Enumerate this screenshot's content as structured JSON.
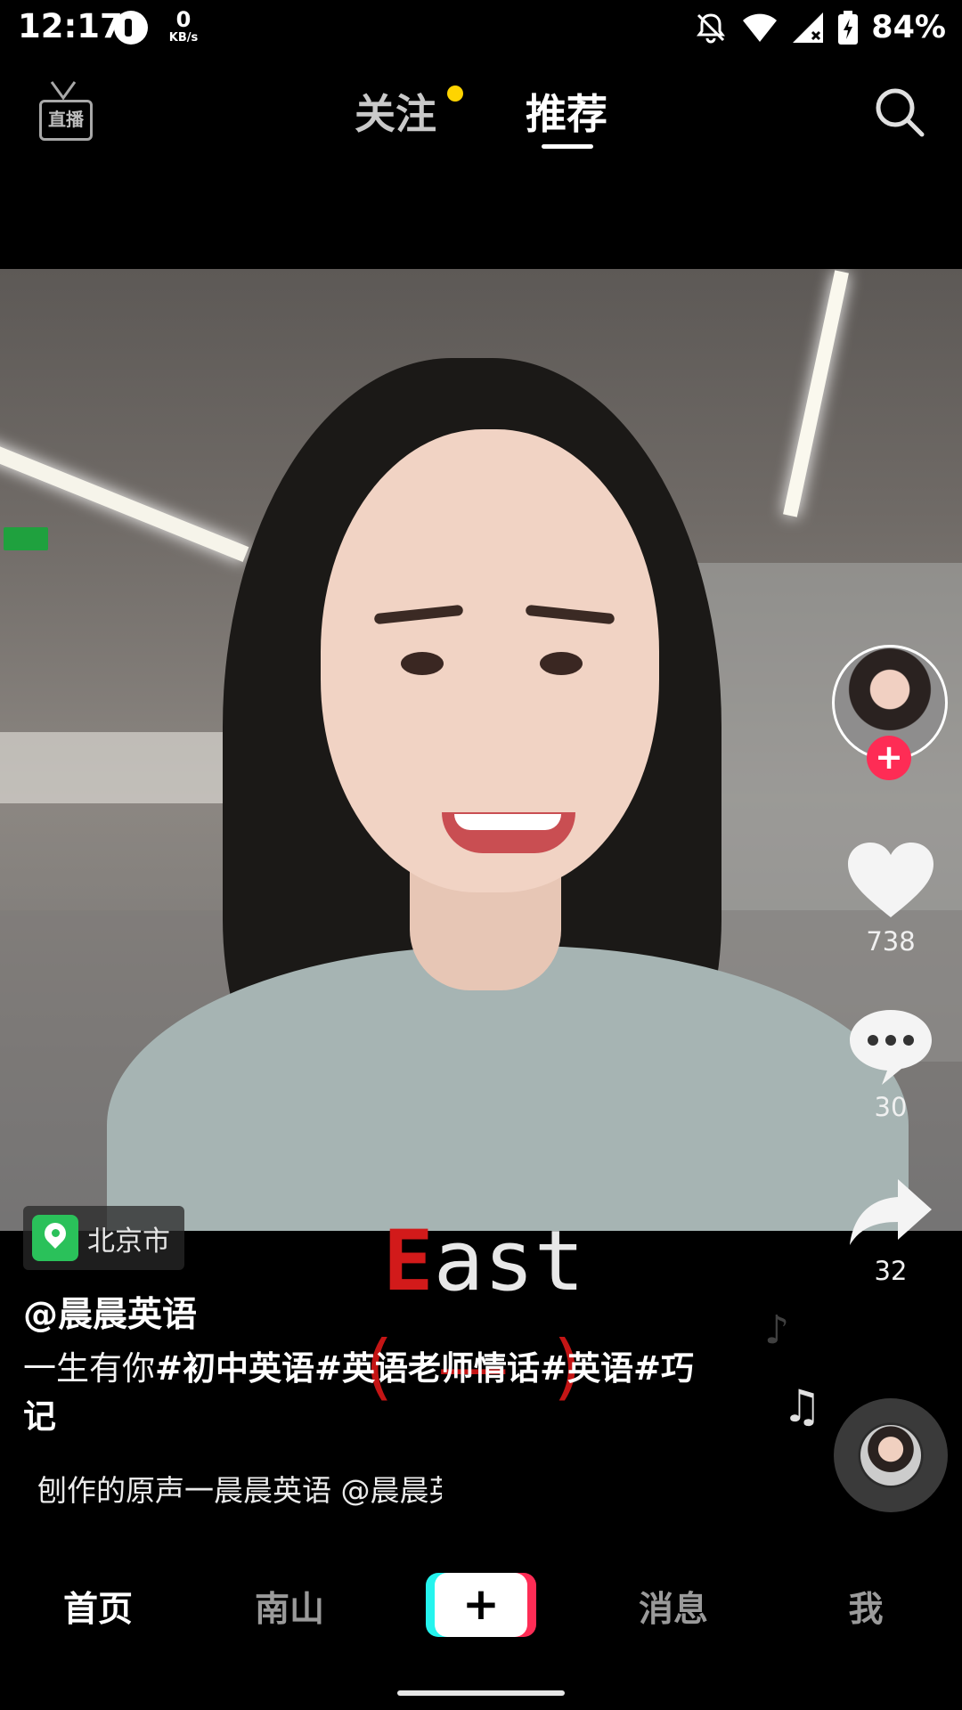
{
  "status_bar": {
    "time": "12:17",
    "net_speed_value": "0",
    "net_speed_unit": "KB/s",
    "battery": "84%"
  },
  "top_nav": {
    "live_label": "直播",
    "tabs": [
      {
        "label": "关注",
        "has_dot": true
      },
      {
        "label": "推荐",
        "active": true
      }
    ],
    "search_icon": "search-icon"
  },
  "video": {
    "subtitle_first_letter": "E",
    "subtitle_rest": "ast",
    "subtitle_brackets": "(—)"
  },
  "actions": {
    "likes": "738",
    "comments": "30",
    "shares": "32"
  },
  "location": {
    "label": "北京市"
  },
  "post": {
    "author": "@晨晨英语",
    "caption_prefix": "一生有你",
    "caption_tags": "#初中英语#英语老师情话#英语#巧记",
    "music_text": "刨作的原声一晨晨英语    @晨晨英语"
  },
  "tab_bar": {
    "home": "首页",
    "nanshan": "南山",
    "create": "+",
    "messages": "消息",
    "me": "我"
  },
  "colors": {
    "accent_red": "#fe2c55",
    "accent_cyan": "#25f4ee",
    "notification_dot": "#ffd400",
    "location_green": "#2ac15a"
  }
}
